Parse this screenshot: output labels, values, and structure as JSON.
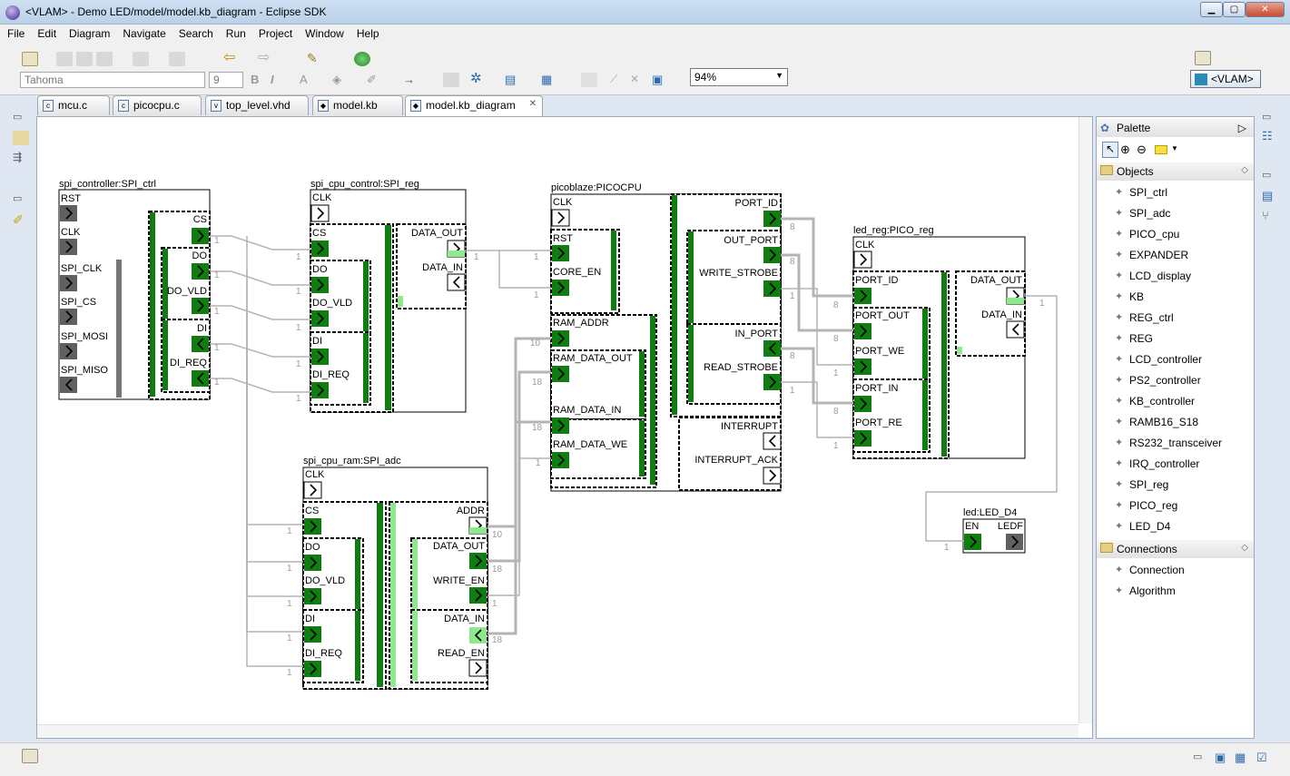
{
  "window": {
    "title": "<VLAM> - Demo LED/model/model.kb_diagram - Eclipse SDK"
  },
  "menu": [
    "File",
    "Edit",
    "Diagram",
    "Navigate",
    "Search",
    "Run",
    "Project",
    "Window",
    "Help"
  ],
  "toolbar": {
    "font_name": "Tahoma",
    "font_size": "9",
    "zoom": "94%",
    "perspective": "<VLAM>"
  },
  "tabs": [
    {
      "label": "mcu.c",
      "icon": "c-file-icon"
    },
    {
      "label": "picocpu.c",
      "icon": "c-file-icon"
    },
    {
      "label": "top_level.vhd",
      "icon": "vhdl-file-icon"
    },
    {
      "label": "model.kb",
      "icon": "kb-file-icon"
    },
    {
      "label": "model.kb_diagram",
      "icon": "diagram-file-icon",
      "active": true
    }
  ],
  "palette": {
    "title": "Palette",
    "groups": [
      {
        "label": "Objects",
        "items": [
          "SPI_ctrl",
          "SPI_adc",
          "PICO_cpu",
          "EXPANDER",
          "LCD_display",
          "KB",
          "REG_ctrl",
          "REG",
          "LCD_controller",
          "PS2_controller",
          "KB_controller",
          "RAMB16_S18",
          "RS232_transceiver",
          "IRQ_controller",
          "SPI_reg",
          "PICO_reg",
          "LED_D4"
        ]
      },
      {
        "label": "Connections",
        "items": [
          "Connection",
          "Algorithm"
        ]
      }
    ]
  },
  "diagram": {
    "blocks": [
      {
        "title": "spi_controller:SPI_ctrl",
        "ports": [
          "RST",
          "CLK",
          "SPI_CLK",
          "SPI_CS",
          "SPI_MOSI",
          "SPI_MISO",
          "CS",
          "DO",
          "DO_VLD",
          "DI",
          "DI_REQ"
        ]
      },
      {
        "title": "spi_cpu_control:SPI_reg",
        "ports": [
          "CLK",
          "CS",
          "DO",
          "DO_VLD",
          "DI",
          "DI_REQ",
          "DATA_OUT",
          "DATA_IN"
        ]
      },
      {
        "title": "spi_cpu_ram:SPI_adc",
        "ports": [
          "CLK",
          "CS",
          "DO",
          "DO_VLD",
          "DI",
          "DI_REQ",
          "ADDR",
          "DATA_OUT",
          "WRITE_EN",
          "DATA_IN",
          "READ_EN"
        ]
      },
      {
        "title": "picoblaze:PICOCPU",
        "ports": [
          "CLK",
          "RST",
          "CORE_EN",
          "RAM_ADDR",
          "RAM_DATA_OUT",
          "RAM_DATA_IN",
          "RAM_DATA_WE",
          "PORT_ID",
          "OUT_PORT",
          "WRITE_STROBE",
          "IN_PORT",
          "READ_STROBE",
          "INTERRUPT",
          "INTERRUPT_ACK"
        ]
      },
      {
        "title": "led_reg:PICO_reg",
        "ports": [
          "CLK",
          "PORT_ID",
          "PORT_OUT",
          "PORT_WE",
          "PORT_IN",
          "PORT_RE",
          "DATA_OUT",
          "DATA_IN"
        ]
      },
      {
        "title": "led:LED_D4",
        "ports": [
          "EN",
          "LEDF"
        ]
      }
    ],
    "widths": [
      "1",
      "8",
      "10",
      "18"
    ]
  }
}
